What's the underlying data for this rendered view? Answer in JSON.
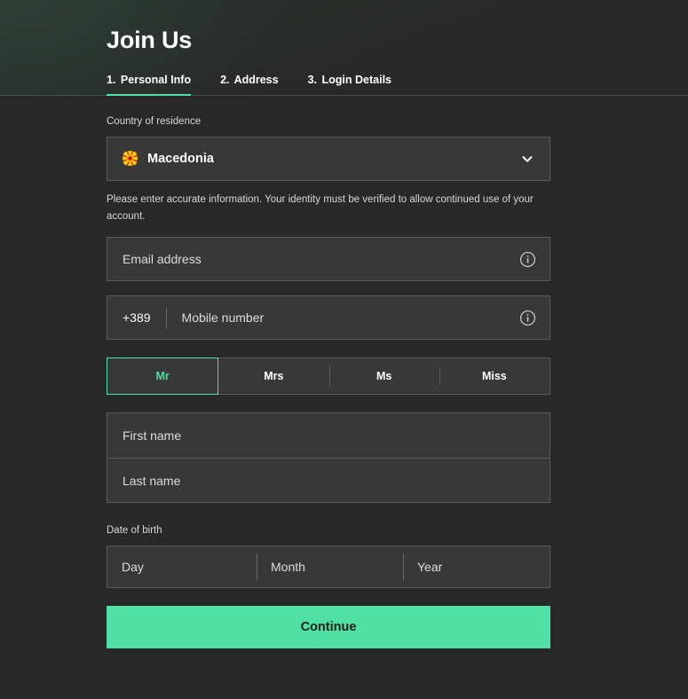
{
  "theme": {
    "accent": "#4ee0a4",
    "background": "#282828",
    "field_background": "#383838",
    "field_border": "#5a5a5a",
    "text": "#ffffff",
    "muted_text": "#d8d8d8"
  },
  "header": {
    "title": "Join Us",
    "tabs": [
      {
        "num": "1.",
        "label": "Personal Info",
        "active": true
      },
      {
        "num": "2.",
        "label": "Address",
        "active": false
      },
      {
        "num": "3.",
        "label": "Login Details",
        "active": false
      }
    ]
  },
  "form": {
    "country": {
      "label": "Country of residence",
      "value": "Macedonia",
      "flag_icon": "macedonia-flag-icon",
      "chevron_icon": "chevron-down-icon"
    },
    "helper_text": "Please enter accurate information. Your identity must be verified to allow continued use of your account.",
    "email": {
      "placeholder": "Email address",
      "value": "",
      "info_icon": "info-icon"
    },
    "mobile": {
      "dial_code": "+389",
      "placeholder": "Mobile number",
      "value": "",
      "info_icon": "info-icon"
    },
    "title_options": [
      {
        "label": "Mr",
        "selected": true
      },
      {
        "label": "Mrs",
        "selected": false
      },
      {
        "label": "Ms",
        "selected": false
      },
      {
        "label": "Miss",
        "selected": false
      }
    ],
    "first_name": {
      "placeholder": "First name",
      "value": ""
    },
    "last_name": {
      "placeholder": "Last name",
      "value": ""
    },
    "date_of_birth": {
      "label": "Date of birth",
      "day": {
        "placeholder": "Day",
        "value": ""
      },
      "month": {
        "placeholder": "Month",
        "value": ""
      },
      "year": {
        "placeholder": "Year",
        "value": ""
      }
    },
    "submit_label": "Continue"
  }
}
